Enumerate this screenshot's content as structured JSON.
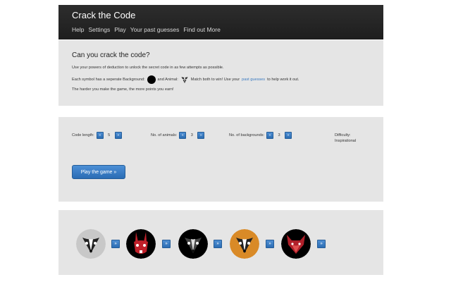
{
  "app": {
    "title": "Crack the Code"
  },
  "nav": [
    "Help",
    "Settings",
    "Play",
    "Your past guesses",
    "Find out More"
  ],
  "hero": {
    "heading": "Can you crack the code?",
    "line1": "Use your powers of deduction to unlock the secret code in as few attempts as possible.",
    "line2_a": "Each symbol has a seperate Background:",
    "line2_b": "and Animal:",
    "line2_c": "Match both to win! Use your",
    "line2_link": "past guesses",
    "line2_d": "to help work it out.",
    "line3": "The harder you make the game, the more points you earn!"
  },
  "settings": {
    "code_length": {
      "label": "Code length:",
      "value": "5"
    },
    "animals": {
      "label": "No. of animals:",
      "value": "3"
    },
    "backgrounds": {
      "label": "No. of backgrounds:",
      "value": "3"
    },
    "difficulty_label": "Difficulty:",
    "difficulty_value": "Inspirational",
    "decrement_glyph": "«",
    "increment_glyph": "»",
    "play_label": "Play the game »"
  },
  "code": {
    "cycle_glyph": "»",
    "symbols": [
      {
        "animal": "badger-icon",
        "background": "#c8c8c8"
      },
      {
        "animal": "rabbit-icon",
        "background": "#000000"
      },
      {
        "animal": "badger-icon",
        "background": "#000000"
      },
      {
        "animal": "badger-icon",
        "background": "#d98a27"
      },
      {
        "animal": "fox-icon",
        "background": "#000000"
      }
    ]
  },
  "colors": {
    "accent": "#2c6db3",
    "navbar": "#222222",
    "panel": "#e5e5e5"
  }
}
